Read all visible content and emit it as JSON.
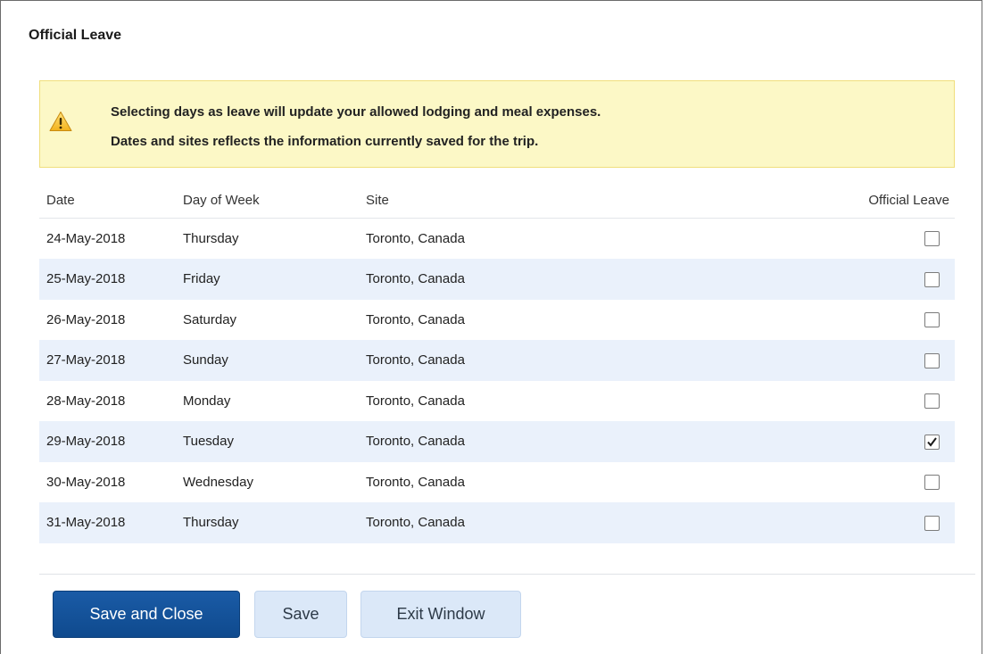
{
  "dialog": {
    "title": "Official Leave"
  },
  "warning": {
    "icon": "warning-icon",
    "line1": "Selecting days as leave will update your allowed lodging and meal expenses.",
    "line2": "Dates and sites reflects the information currently saved for the trip."
  },
  "table": {
    "headers": {
      "date": "Date",
      "day_of_week": "Day of Week",
      "site": "Site",
      "official_leave": "Official Leave"
    },
    "rows": [
      {
        "date": "24-May-2018",
        "day": "Thursday",
        "site": "Toronto, Canada",
        "leave": false
      },
      {
        "date": "25-May-2018",
        "day": "Friday",
        "site": "Toronto, Canada",
        "leave": false
      },
      {
        "date": "26-May-2018",
        "day": "Saturday",
        "site": "Toronto, Canada",
        "leave": false
      },
      {
        "date": "27-May-2018",
        "day": "Sunday",
        "site": "Toronto, Canada",
        "leave": false
      },
      {
        "date": "28-May-2018",
        "day": "Monday",
        "site": "Toronto, Canada",
        "leave": false
      },
      {
        "date": "29-May-2018",
        "day": "Tuesday",
        "site": "Toronto, Canada",
        "leave": true
      },
      {
        "date": "30-May-2018",
        "day": "Wednesday",
        "site": "Toronto, Canada",
        "leave": false
      },
      {
        "date": "31-May-2018",
        "day": "Thursday",
        "site": "Toronto, Canada",
        "leave": false
      }
    ]
  },
  "buttons": {
    "save_and_close": "Save and Close",
    "save": "Save",
    "exit_window": "Exit Window"
  },
  "colors": {
    "primary_button": "#14529b",
    "secondary_button": "#dbe8f8",
    "warning_background": "#fcf8c6",
    "alt_row": "#eaf1fb"
  }
}
